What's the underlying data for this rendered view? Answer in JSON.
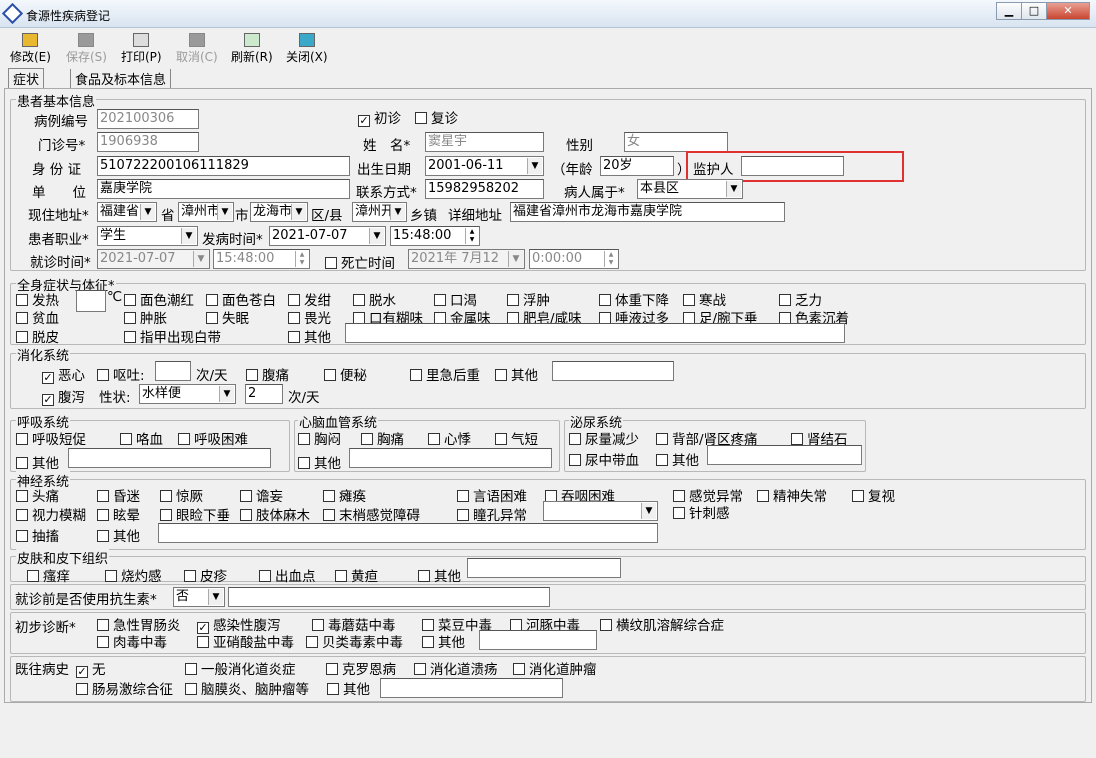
{
  "window": {
    "title": "食源性疾病登记",
    "min": "▁",
    "max": "□",
    "close": "✕"
  },
  "toolbar": {
    "modify": "修改(E)",
    "save": "保存(S)",
    "print": "打印(P)",
    "cancel": "取消(C)",
    "refresh": "刷新(R)",
    "close": "关闭(X)"
  },
  "tabs": [
    "症状",
    "食品及标本信息"
  ],
  "basic": {
    "title": "患者基本信息",
    "case_no_label": "病例编号",
    "case_no": "202100306",
    "first_visit": "初诊",
    "revisit": "复诊",
    "clinic_label": "门诊号*",
    "clinic_no": "1906938",
    "name_label": "姓　名*",
    "name": "窦星宇",
    "gender_label": "性别",
    "gender": "女",
    "id_label": "身 份 证",
    "id_no": "510722200106111829",
    "birth_label": "出生日期",
    "birth": "2001-06-11",
    "age_label_l": "（年龄",
    "age": "20岁",
    "age_label_r": "）",
    "guardian_label": "监护人",
    "guardian": "",
    "unit_label": "单　　位",
    "unit": "嘉庚学院",
    "contact_label": "联系方式*",
    "contact": "15982958202",
    "belong_label": "病人属于*",
    "belong": "本县区",
    "addr_label": "现住地址*",
    "province": "福建省",
    "province_suffix": "省",
    "city": "漳州市",
    "city_suffix": "市",
    "district": "龙海市",
    "district_suffix": "区/县",
    "town": "漳州开",
    "town_suffix": "乡镇",
    "detail_label": "详细地址",
    "detail": "福建省漳州市龙海市嘉庚学院",
    "job_label": "患者职业*",
    "job": "学生",
    "onset_label": "发病时间*",
    "onset_date": "2021-07-07",
    "onset_time": "15:48:00",
    "visit_label": "就诊时间*",
    "visit_date": "2021-07-07",
    "visit_time": "15:48:00",
    "death_label": "死亡时间",
    "death_date": "2021年 7月12",
    "death_time": "0:00:00"
  },
  "general": {
    "title": "全身症状与体征*",
    "fever": "发热",
    "temp_unit": "℃",
    "flush": "面色潮红",
    "pale": "面色苍白",
    "cyanosis": "发绀",
    "dehydration": "脱水",
    "thirst": "口渴",
    "edema": "浮肿",
    "weight_loss": "体重下降",
    "chills": "寒战",
    "fatigue": "乏力",
    "anemia": "贫血",
    "swelling": "肿胀",
    "insomnia": "失眠",
    "photophobia": "畏光",
    "garlic": "口有糊味",
    "metal": "金属味",
    "soap": "肥皂/咸味",
    "saliva": "唾液过多",
    "wrist": "足/腕下垂",
    "pigment": "色素沉着",
    "peeling": "脱皮",
    "nails": "指甲出现白带",
    "other": "其他"
  },
  "digestive": {
    "title": "消化系统",
    "nausea": "恶心",
    "vomit": "呕吐:",
    "per_day": "次/天",
    "bellyache": "腹痛",
    "constipation": "便秘",
    "tenesmus": "里急后重",
    "other": "其他",
    "diarrhea": "腹泻",
    "nature": "性状:",
    "nature_val": "水样便",
    "times": "2",
    "per_day2": "次/天"
  },
  "respiratory": {
    "title": "呼吸系统",
    "short": "呼吸短促",
    "hemoptysis": "咯血",
    "difficulty": "呼吸困难",
    "other": "其他"
  },
  "cardio": {
    "title": "心脑血管系统",
    "chest_tight": "胸闷",
    "chest_pain": "胸痛",
    "palpitation": "心悸",
    "breath": "气短",
    "other": "其他"
  },
  "urinary": {
    "title": "泌尿系统",
    "less_urine": "尿量减少",
    "back_pain": "背部/肾区疼痛",
    "stone": "肾结石",
    "hematuria": "尿中带血",
    "other": "其他"
  },
  "neuro": {
    "title": "神经系统",
    "headache": "头痛",
    "coma": "昏迷",
    "convulsion": "惊厥",
    "delirium": "谵妄",
    "paralysis": "瘫痪",
    "speech": "言语困难",
    "swallow": "吞咽困难",
    "sensory": "感觉异常",
    "mental": "精神失常",
    "double_vision": "复视",
    "blur": "视力模糊",
    "dizzy": "眩晕",
    "ptosis": "眼睑下垂",
    "limb_numb": "肢体麻木",
    "peripheral": "末梢感觉障碍",
    "pupil": "瞳孔异常",
    "needle": "针刺感",
    "twitch": "抽搐",
    "other": "其他"
  },
  "skin": {
    "title": "皮肤和皮下组织",
    "itch": "瘙痒",
    "burn": "烧灼感",
    "rash": "皮疹",
    "bleeding": "出血点",
    "jaundice": "黄疸",
    "other": "其他"
  },
  "antibiotic": {
    "label": "就诊前是否使用抗生素*",
    "value": "否"
  },
  "diagnosis": {
    "label": "初步诊断*",
    "gastro": "急性胃肠炎",
    "infective": "感染性腹泻",
    "mushroom": "毒蘑菇中毒",
    "bean": "菜豆中毒",
    "puffer": "河豚中毒",
    "rhabdo": "横纹肌溶解综合症",
    "meat": "肉毒中毒",
    "nitrite": "亚硝酸盐中毒",
    "shellfish": "贝类毒素中毒",
    "other": "其他"
  },
  "history": {
    "label": "既往病史",
    "none": "无",
    "inflam": "一般消化道炎症",
    "crohn": "克罗恩病",
    "ulcer": "消化道溃疡",
    "tumor": "消化道肿瘤",
    "ibs": "肠易激综合征",
    "brain": "脑膜炎、脑肿瘤等",
    "other": "其他"
  }
}
